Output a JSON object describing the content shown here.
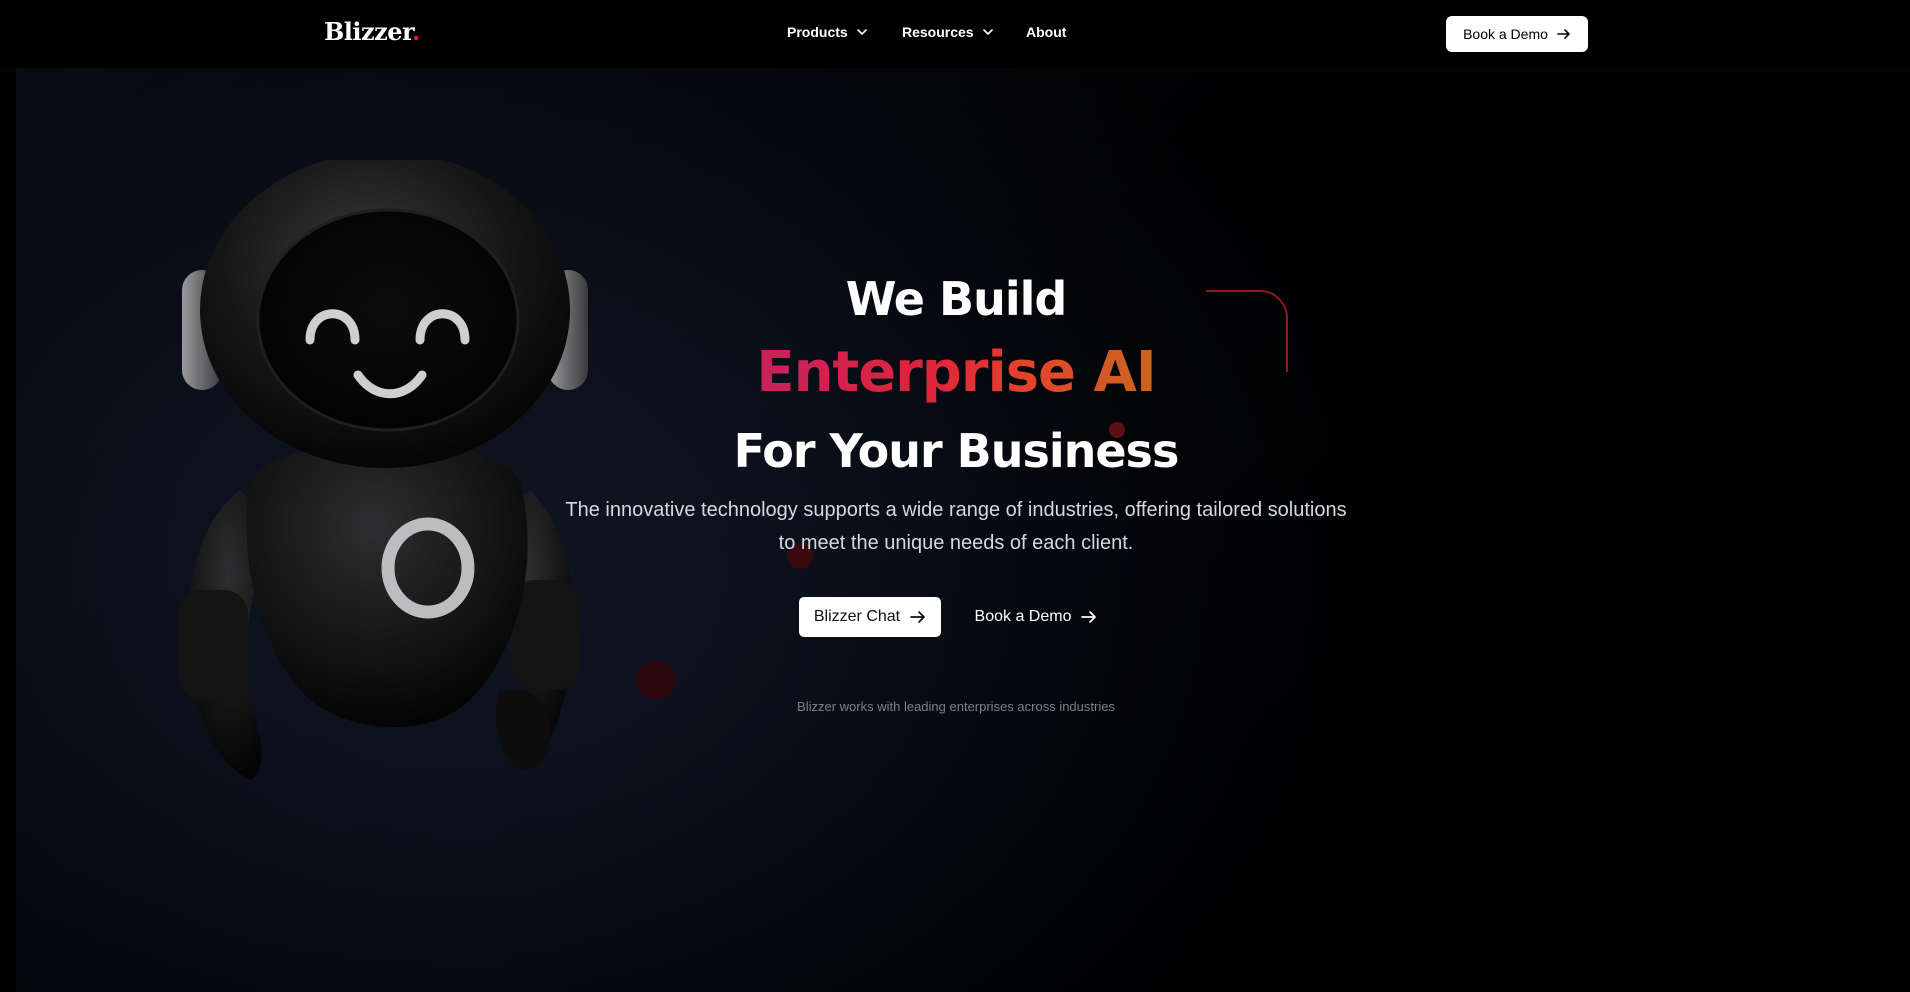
{
  "brand": {
    "logo_text": "Blizzer",
    "logo_dot": ".",
    "accent_color": "#e0182f"
  },
  "nav": {
    "items": [
      {
        "label": "Products",
        "has_dropdown": true
      },
      {
        "label": "Resources",
        "has_dropdown": true
      },
      {
        "label": "About",
        "has_dropdown": false
      }
    ],
    "cta_label": "Book a Demo"
  },
  "hero": {
    "title_line1": "We Build",
    "title_line2": "Enterprise AI",
    "title_line3": "For Your Business",
    "subtitle": "The innovative technology supports a wide range of industries, offering tailored solutions to meet the unique needs of each client.",
    "primary_button": "Blizzer Chat",
    "secondary_button": "Book a Demo",
    "trust_text": "Blizzer works with leading enterprises across industries",
    "gradient_colors": [
      "#c7215d",
      "#e0253a",
      "#e2472a",
      "#c9651f"
    ]
  },
  "icons": {
    "chevron": "chevron-down-icon",
    "arrow": "arrow-right-icon",
    "mascot": "robot-mascot"
  }
}
